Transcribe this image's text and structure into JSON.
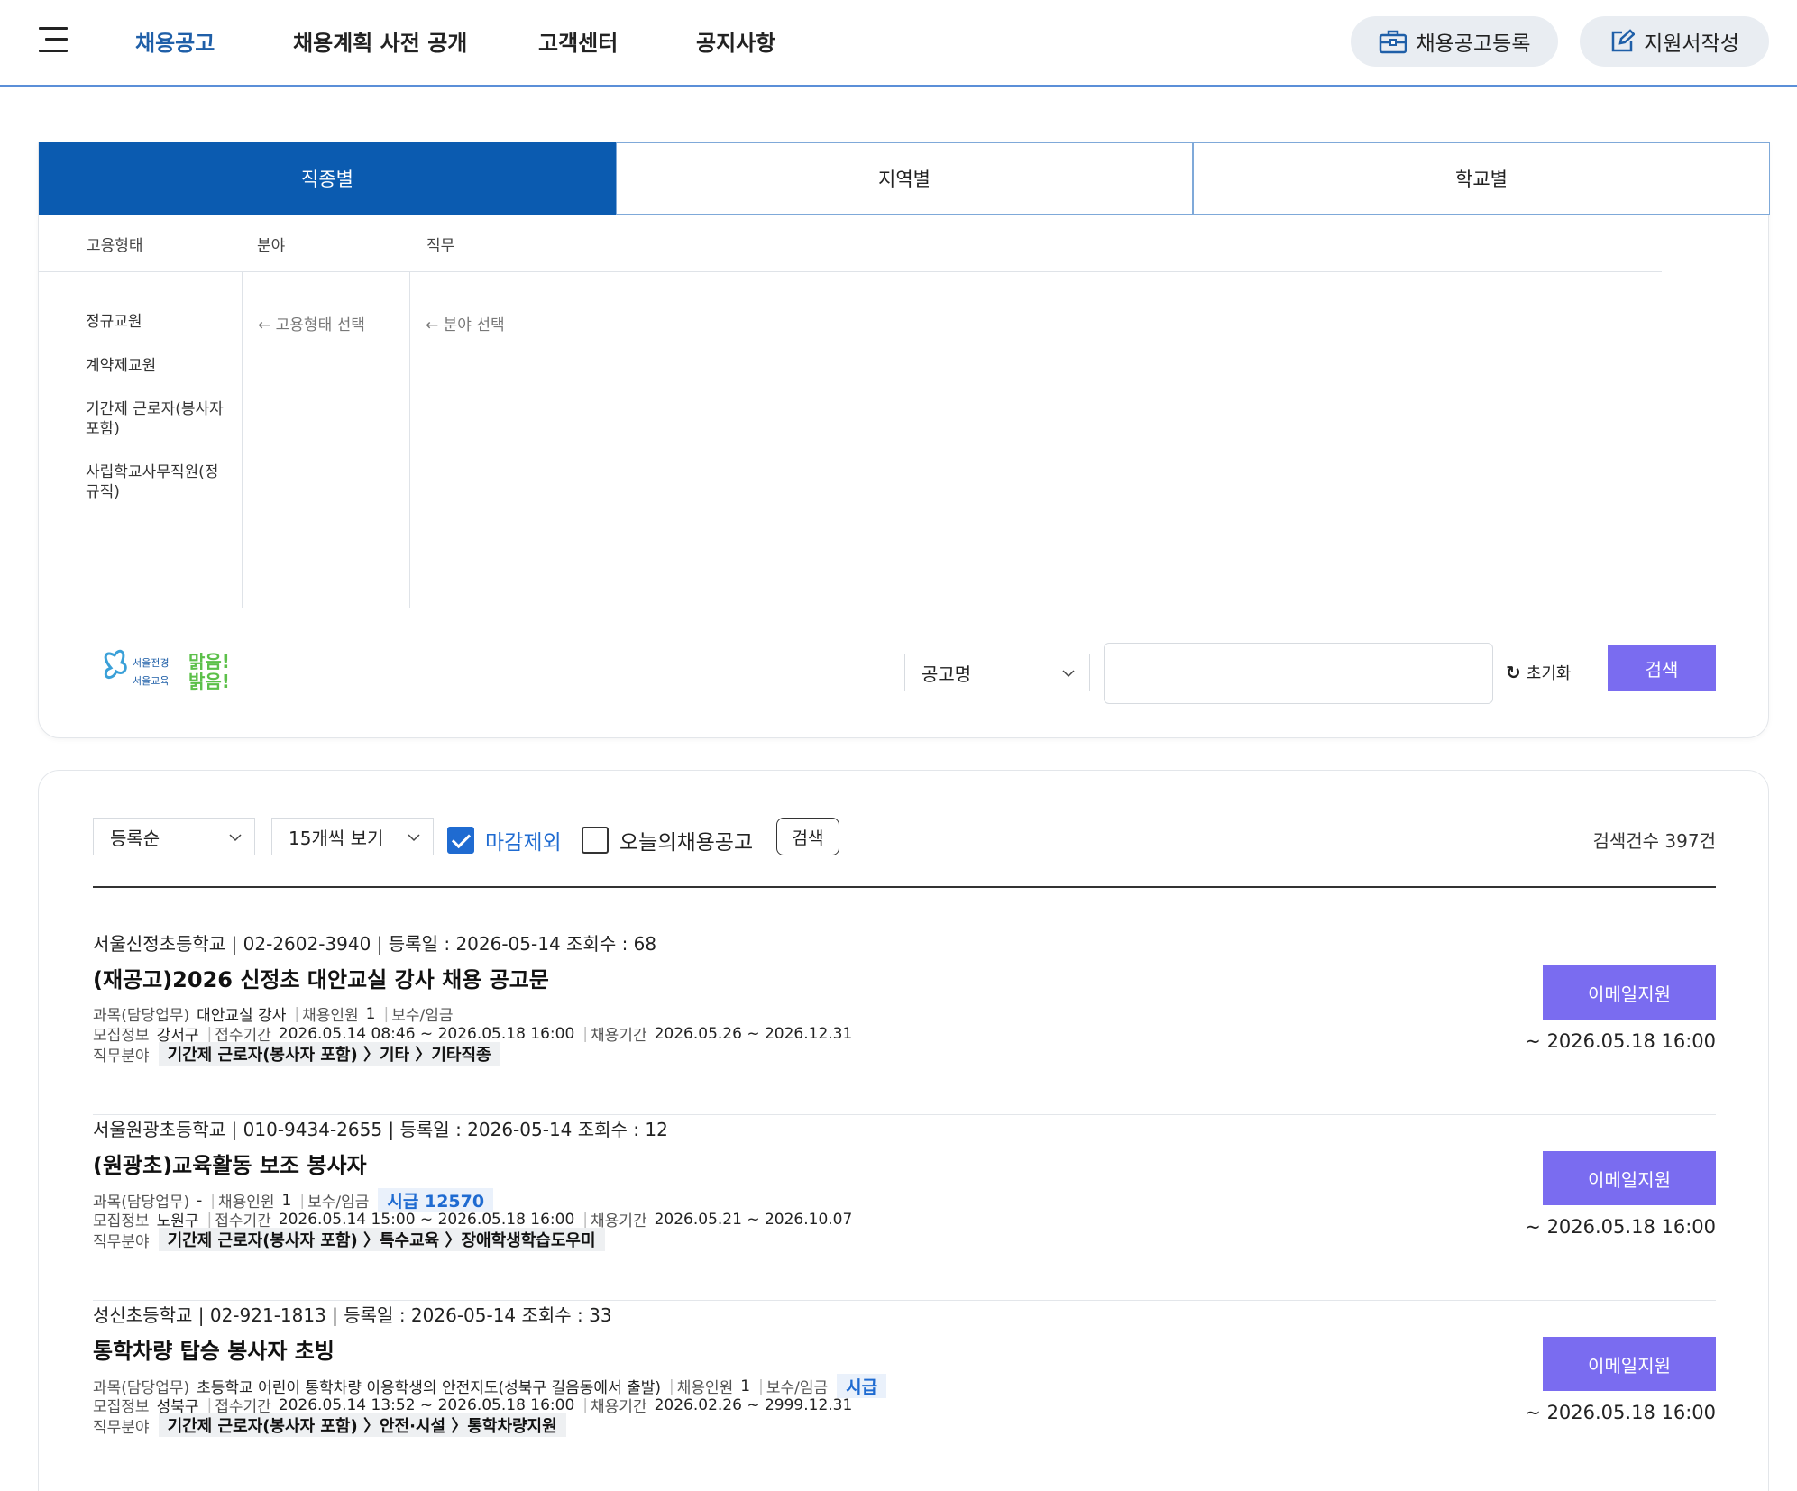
{
  "header": {
    "nav": [
      "채용공고",
      "채용계획 사전 공개",
      "고객센터",
      "공지사항"
    ],
    "register_label": "채용공고등록",
    "apply_form_label": "지원서작성"
  },
  "filter": {
    "tabs": [
      "직종별",
      "지역별",
      "학교별"
    ],
    "columns": [
      "고용형태",
      "분야",
      "직무"
    ],
    "employment_types": [
      "정규교원",
      "계약제교원",
      "기간제 근로자(봉사자 포함)",
      "사립학교사무직원(정규직)"
    ],
    "field_hint": "← 고용형태 선택",
    "duty_hint": "← 분야 선택",
    "logo_alt": "서울전경 맑음! 서울교육 밝음!",
    "search_type": "공고명",
    "search_value": "",
    "reset_label": "초기화",
    "search_label": "검색"
  },
  "results": {
    "sort": "등록순",
    "per_page": "15개씩 보기",
    "exclude_closed": "마감제외",
    "today_only": "오늘의채용공고",
    "search_label": "검색",
    "count_label": "검색건수 397건",
    "jobs": [
      {
        "meta": "서울신정초등학교 | 02-2602-3940 | 등록일 : 2026-05-14 조회수 : 68",
        "title": "(재공고)2026 신정초 대안교실 강사 채용 공고문",
        "subject_label": "과목(담당업무)",
        "subject": "대안교실 강사",
        "headcount_label": "채용인원",
        "headcount": "1",
        "pay_label": "보수/임금",
        "pay": "",
        "region_label": "모집정보",
        "region": "강서구",
        "receipt_label": "접수기간",
        "receipt": "2026.05.14 08:46 ~ 2026.05.18 16:00",
        "period_label": "채용기간",
        "period": "2026.05.26 ~ 2026.12.31",
        "category_label": "직무분야",
        "category": "기간제 근로자(봉사자 포함) 〉기타 〉기타직종",
        "apply_label": "이메일지원",
        "deadline": "~ 2026.05.18 16:00"
      },
      {
        "meta": "서울원광초등학교 | 010-9434-2655 | 등록일 : 2026-05-14 조회수 : 12",
        "title": "(원광초)교육활동 보조 봉사자",
        "subject_label": "과목(담당업무)",
        "subject": "-",
        "headcount_label": "채용인원",
        "headcount": "1",
        "pay_label": "보수/임금",
        "pay": "시급 12570",
        "region_label": "모집정보",
        "region": "노원구",
        "receipt_label": "접수기간",
        "receipt": "2026.05.14 15:00 ~ 2026.05.18 16:00",
        "period_label": "채용기간",
        "period": "2026.05.21 ~ 2026.10.07",
        "category_label": "직무분야",
        "category": "기간제 근로자(봉사자 포함) 〉특수교육 〉장애학생학습도우미",
        "apply_label": "이메일지원",
        "deadline": "~ 2026.05.18 16:00"
      },
      {
        "meta": "성신초등학교 | 02-921-1813 | 등록일 : 2026-05-14 조회수 : 33",
        "title": "통학차량 탑승 봉사자 초빙",
        "subject_label": "과목(담당업무)",
        "subject": "초등학교 어린이 통학차량 이용학생의 안전지도(성북구 길음동에서 출발)",
        "headcount_label": "채용인원",
        "headcount": "1",
        "pay_label": "보수/임금",
        "pay": "시급",
        "region_label": "모집정보",
        "region": "성북구",
        "receipt_label": "접수기간",
        "receipt": "2026.05.14 13:52 ~ 2026.05.18 16:00",
        "period_label": "채용기간",
        "period": "2026.02.26 ~ 2999.12.31",
        "category_label": "직무분야",
        "category": "기간제 근로자(봉사자 포함) 〉안전·시설 〉통학차량지원",
        "apply_label": "이메일지원",
        "deadline": "~ 2026.05.18 16:00"
      }
    ]
  },
  "colors": {
    "primary": "#0b5bb0",
    "accent": "#7a6cf0",
    "link": "#1f6bd1"
  }
}
